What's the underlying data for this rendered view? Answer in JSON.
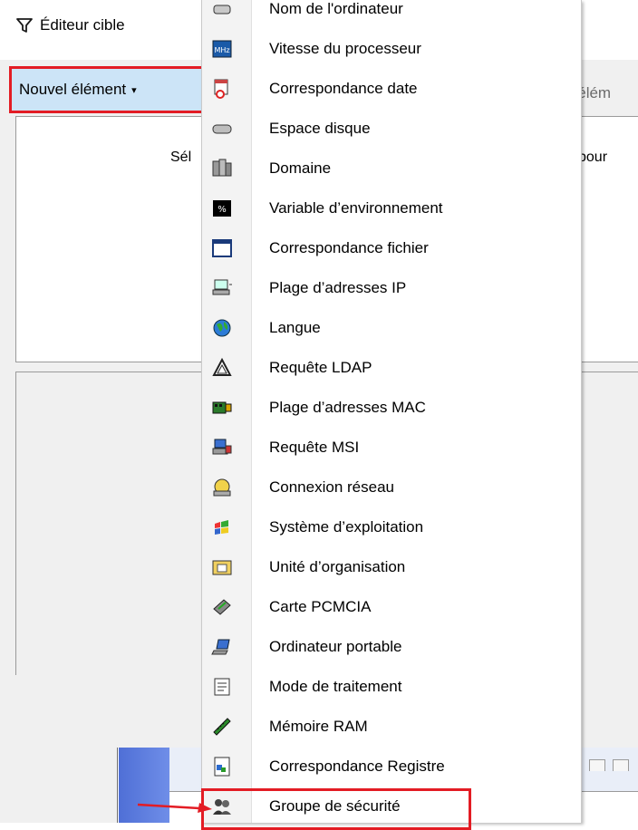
{
  "editor": {
    "title": "Éditeur cible",
    "new_item_label": "Nouvel élément",
    "new_item_arrow": "▾",
    "upper_text_left": "Sél",
    "upper_text_right": "pour",
    "truncated_label": "'élém"
  },
  "menu": {
    "items": [
      {
        "label": "Nom de l'ordinateur",
        "icon": "computer-name-icon"
      },
      {
        "label": "Vitesse du processeur",
        "icon": "processor-speed-icon"
      },
      {
        "label": "Correspondance date",
        "icon": "date-match-icon"
      },
      {
        "label": "Espace disque",
        "icon": "disk-space-icon"
      },
      {
        "label": "Domaine",
        "icon": "domain-icon"
      },
      {
        "label": "Variable d’environnement",
        "icon": "environment-variable-icon"
      },
      {
        "label": "Correspondance fichier",
        "icon": "file-match-icon"
      },
      {
        "label": "Plage d’adresses IP",
        "icon": "ip-range-icon"
      },
      {
        "label": "Langue",
        "icon": "language-icon"
      },
      {
        "label": "Requête LDAP",
        "icon": "ldap-query-icon"
      },
      {
        "label": "Plage d’adresses MAC",
        "icon": "mac-range-icon"
      },
      {
        "label": "Requête MSI",
        "icon": "msi-query-icon"
      },
      {
        "label": "Connexion réseau",
        "icon": "network-connection-icon"
      },
      {
        "label": "Système d’exploitation",
        "icon": "operating-system-icon"
      },
      {
        "label": "Unité d’organisation",
        "icon": "organizational-unit-icon"
      },
      {
        "label": "Carte PCMCIA",
        "icon": "pcmcia-card-icon"
      },
      {
        "label": "Ordinateur portable",
        "icon": "laptop-icon"
      },
      {
        "label": "Mode de traitement",
        "icon": "processing-mode-icon"
      },
      {
        "label": "Mémoire RAM",
        "icon": "ram-memory-icon"
      },
      {
        "label": "Correspondance Registre",
        "icon": "registry-match-icon"
      },
      {
        "label": "Groupe de sécurité",
        "icon": "security-group-icon"
      }
    ]
  },
  "colors": {
    "highlight_red": "#e31c24",
    "button_hover_blue": "#cce4f7"
  }
}
